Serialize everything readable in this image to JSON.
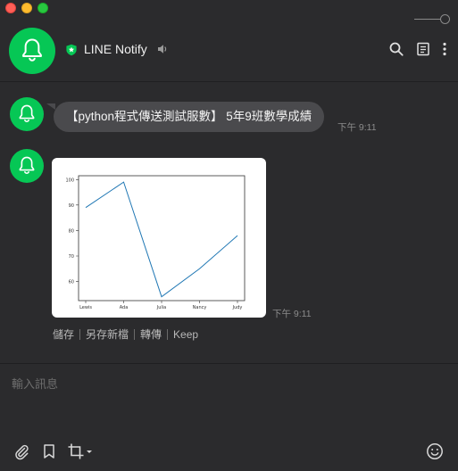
{
  "window": {
    "controls": [
      "close",
      "minimize",
      "maximize"
    ]
  },
  "header": {
    "title": "LINE Notify",
    "icons": [
      "bell-icon",
      "verified-shield-icon",
      "speaker-icon",
      "search-icon",
      "note-icon",
      "more-icon"
    ]
  },
  "messages": [
    {
      "type": "text",
      "text": "【python程式傳送測試服數】 5年9班數學成績",
      "time": "下午 9:11"
    },
    {
      "type": "image",
      "time": "下午 9:11"
    }
  ],
  "image_actions": [
    "儲存",
    "另存新檔",
    "轉傳",
    "Keep"
  ],
  "composer": {
    "placeholder": "輸入訊息",
    "tools": [
      "paperclip-icon",
      "bookmark-icon",
      "crop-icon",
      "emoji-icon"
    ]
  },
  "chart_data": {
    "type": "line",
    "categories": [
      "Lewis",
      "Ada",
      "Julia",
      "Nancy",
      "Judy"
    ],
    "series": [
      {
        "values": [
          89,
          99,
          54,
          65,
          78
        ],
        "color": "#1f77b4"
      }
    ],
    "yticks": [
      60,
      70,
      80,
      90,
      100
    ],
    "ylim": [
      52.5,
      101.5
    ],
    "xlabel": "",
    "ylabel": "",
    "title": ""
  }
}
